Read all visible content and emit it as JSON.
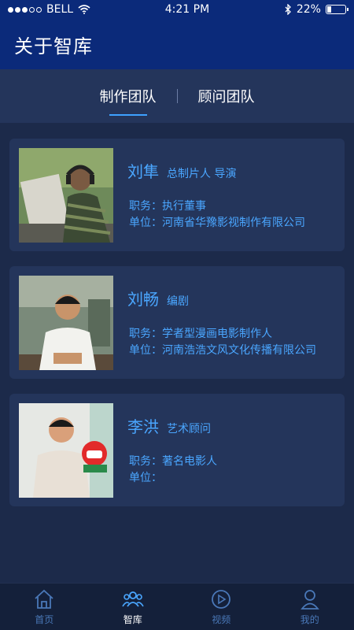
{
  "statusbar": {
    "carrier": "BELL",
    "time": "4:21 PM",
    "battery": "22%",
    "battery_level": 0.22,
    "signal_full": 3,
    "signal_total": 5
  },
  "header": {
    "title": "关于智库"
  },
  "segments": [
    {
      "label": "制作团队",
      "active": true
    },
    {
      "label": "顾问团队",
      "active": false
    }
  ],
  "members": [
    {
      "name": "刘隼",
      "role": "总制片人 导演",
      "duty": "职务：执行董事",
      "unit": "单位：河南省华豫影视制作有限公司"
    },
    {
      "name": "刘畅",
      "role": "编剧",
      "duty": "职务：学者型漫画电影制作人",
      "unit": "单位：河南浩浩文风文化传播有限公司"
    },
    {
      "name": "李洪",
      "role": "艺术顾问",
      "duty": "职务：著名电影人",
      "unit": "单位："
    }
  ],
  "tabbar": [
    {
      "label": "首页",
      "icon": "home-icon",
      "active": false
    },
    {
      "label": "智库",
      "icon": "team-icon",
      "active": true
    },
    {
      "label": "视频",
      "icon": "play-icon",
      "active": false
    },
    {
      "label": "我的",
      "icon": "user-icon",
      "active": false
    }
  ],
  "colors": {
    "accent": "#4aa6ff",
    "nav": "#0b2a7a",
    "card": "#24355b",
    "background": "#1c2a4a",
    "tab_inactive": "#4a78b8"
  }
}
